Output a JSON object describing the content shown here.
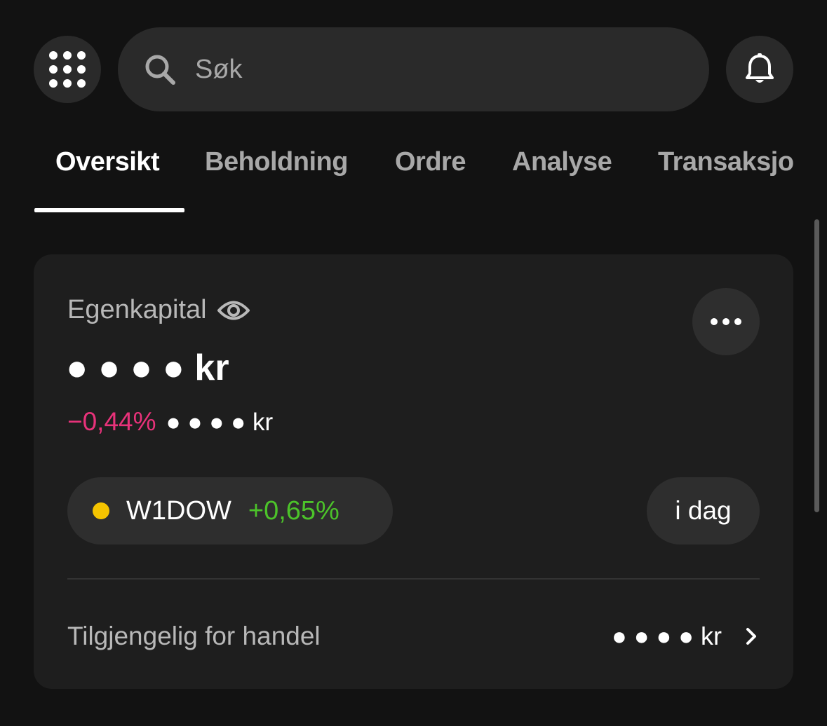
{
  "header": {
    "search_placeholder": "Søk",
    "menu_icon": "grid-menu-icon",
    "bell_icon": "bell-icon"
  },
  "tabs": [
    {
      "label": "Oversikt",
      "active": true
    },
    {
      "label": "Beholdning",
      "active": false
    },
    {
      "label": "Ordre",
      "active": false
    },
    {
      "label": "Analyse",
      "active": false
    },
    {
      "label": "Transaksjo",
      "active": false
    }
  ],
  "card": {
    "equity_label": "Egenkapital",
    "equity_value": "● ● ● ● kr",
    "change_percent": "−0,44%",
    "change_amount": "● ● ● ● kr",
    "index": {
      "name": "W1DOW",
      "change": "+0,65%",
      "dot_color": "#f5c400"
    },
    "period": "i dag",
    "available_label": "Tilgjengelig for handel",
    "available_value": "● ● ● ● kr"
  },
  "colors": {
    "negative": "#e8327a",
    "positive": "#4cc32a",
    "background": "#121212",
    "card": "#1e1e1e"
  }
}
